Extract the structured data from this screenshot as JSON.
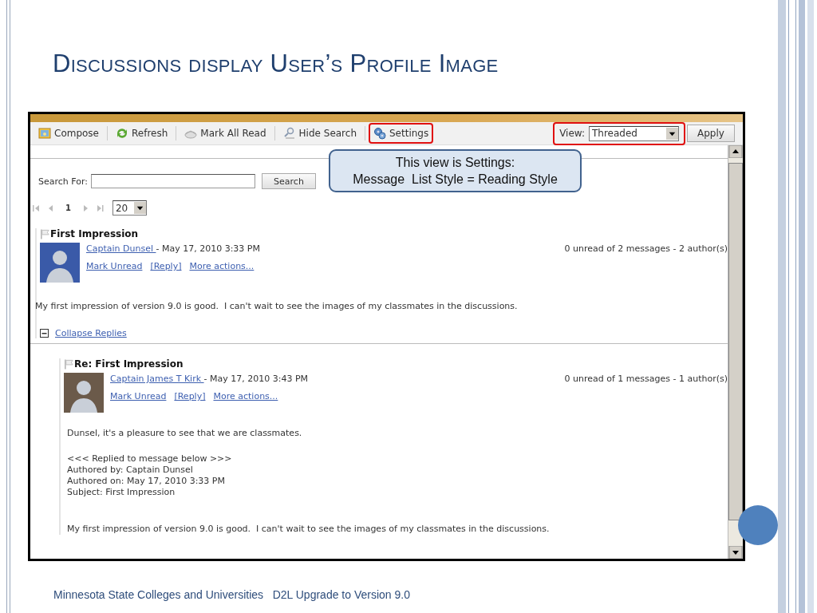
{
  "slide": {
    "title": "Discussions display User’s Profile Image",
    "footer": "Minnesota State Colleges and Universities   D2L Upgrade to Version 9.0"
  },
  "toolbar": {
    "buttons": [
      {
        "label": "Compose",
        "kind": "compose",
        "highlighted": false
      },
      {
        "label": "Refresh",
        "kind": "refresh",
        "highlighted": false
      },
      {
        "label": "Mark All Read",
        "kind": "markread",
        "highlighted": false
      },
      {
        "label": "Hide Search",
        "kind": "hidesearch",
        "highlighted": false
      },
      {
        "label": "Settings",
        "kind": "settings",
        "highlighted": true
      }
    ],
    "view_label": "View:",
    "view_value": "Threaded",
    "view_highlighted": true,
    "apply": "Apply"
  },
  "callout": {
    "lines": [
      "This view is Settings:",
      "Message  List Style = Reading Style"
    ]
  },
  "search": {
    "label": "Search For:",
    "button": "Search"
  },
  "pager": {
    "page": "1",
    "page_size": "20"
  },
  "posts": [
    {
      "subject": "First Impression",
      "reply": false,
      "author": "Captain Dunsel ",
      "date": "- May 17, 2010 3:33 PM",
      "stats": "0 unread of 2 messages - 2 author(s)",
      "actions": [
        "Mark Unread",
        "[Reply]",
        "More actions..."
      ],
      "paragraphs": [
        "My first impression of version 9.0 is good.  I can't wait to see the images of my classmates in the discussions."
      ],
      "collapse": "Collapse Replies"
    },
    {
      "subject": "Re: First Impression",
      "reply": true,
      "author": "Captain James T Kirk ",
      "date": "- May 17, 2010 3:43 PM",
      "stats": "0 unread of 1 messages - 1 author(s)",
      "actions": [
        "Mark Unread",
        "[Reply]",
        "More actions..."
      ],
      "paragraphs": [
        "Dunsel, it's a pleasure to see that we are classmates.",
        "<<< Replied to message below >>>\nAuthored by: Captain Dunsel\nAuthored on: May 17, 2010 3:33 PM\nSubject: First Impression\n\n",
        "My first impression of version 9.0 is good.  I can't wait to see the images of my classmates in the discussions."
      ]
    }
  ]
}
